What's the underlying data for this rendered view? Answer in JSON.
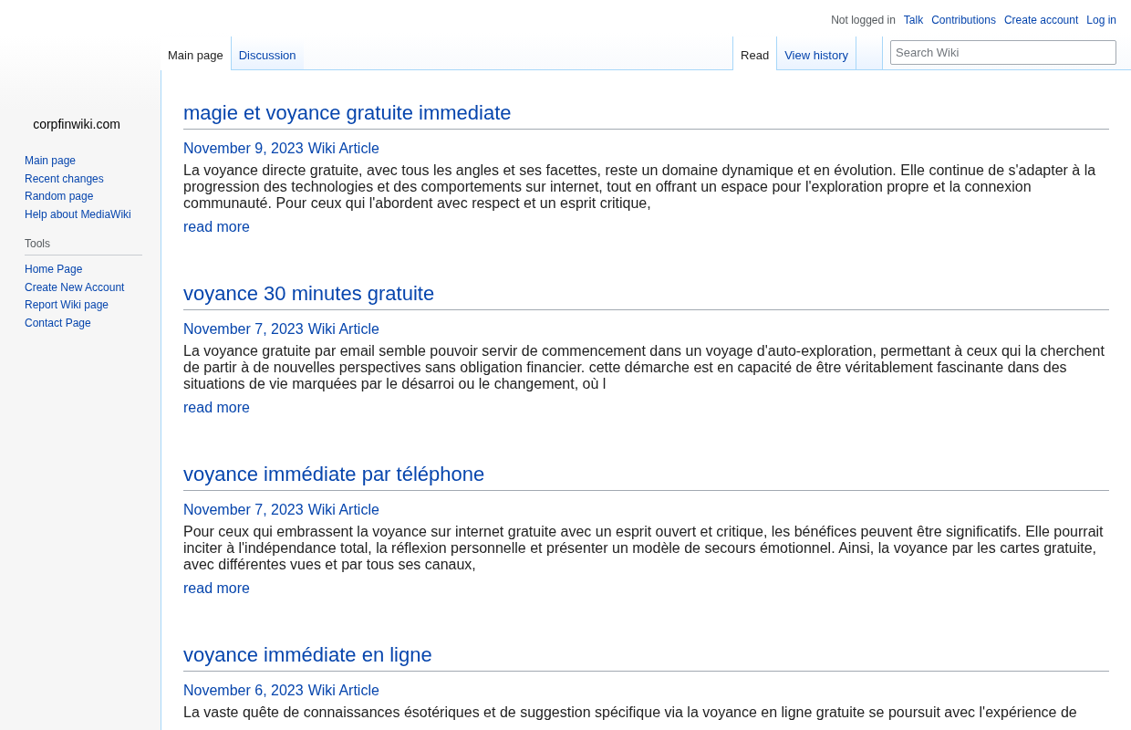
{
  "personal_tools": {
    "status": "Not logged in",
    "links": [
      "Talk",
      "Contributions",
      "Create account",
      "Log in"
    ]
  },
  "site_name": "corpfinwiki.com",
  "sidebar": {
    "navigation": [
      "Main page",
      "Recent changes",
      "Random page",
      "Help about MediaWiki"
    ],
    "tools": {
      "heading": "Tools",
      "items": [
        "Home Page",
        "Create New Account",
        "Report Wiki page",
        "Contact Page"
      ]
    }
  },
  "namespace_tabs": [
    {
      "label": "Main page",
      "selected": true
    },
    {
      "label": "Discussion",
      "selected": false
    }
  ],
  "view_tabs": [
    {
      "label": "Read",
      "selected": true
    },
    {
      "label": "View history",
      "selected": false
    }
  ],
  "search": {
    "placeholder": "Search Wiki"
  },
  "articles": [
    {
      "title": "magie et voyance gratuite immediate",
      "date": "November 9, 2023",
      "category": "Wiki Article",
      "excerpt": "La voyance directe gratuite, avec tous les angles et ses facettes, reste un domaine dynamique et en évolution. Elle continue de s'adapter à la progression des technologies et des comportements sur internet, tout en offrant un espace pour l'exploration propre et la connexion communauté. Pour ceux qui l'abordent avec respect et un esprit critique,",
      "read_more": "read more"
    },
    {
      "title": "voyance 30 minutes gratuite",
      "date": "November 7, 2023",
      "category": "Wiki Article",
      "excerpt": "La voyance gratuite par email semble pouvoir servir de commencement dans un voyage d'auto-exploration, permettant à ceux qui la cherchent de partir à de nouvelles perspectives sans obligation financier. cette démarche est en capacité de être véritablement fascinante dans des situations de vie marquées par le désarroi ou le changement, où l",
      "read_more": "read more"
    },
    {
      "title": "voyance immédiate par téléphone",
      "date": "November 7, 2023",
      "category": "Wiki Article",
      "excerpt": "Pour ceux qui embrassent la voyance sur internet gratuite avec un esprit ouvert et critique, les bénéfices peuvent être significatifs. Elle pourrait inciter à l'indépendance total, la réflexion personnelle et présenter un modèle de secours émotionnel. Ainsi, la voyance par les cartes gratuite, avec différentes vues et par tous ses canaux,",
      "read_more": "read more"
    },
    {
      "title": "voyance immédiate en ligne",
      "date": "November 6, 2023",
      "category": "Wiki Article",
      "excerpt": "La vaste quête de connaissances ésotériques et de suggestion spécifique via la voyance en ligne gratuite se poursuit avec l'expérience de"
    }
  ]
}
